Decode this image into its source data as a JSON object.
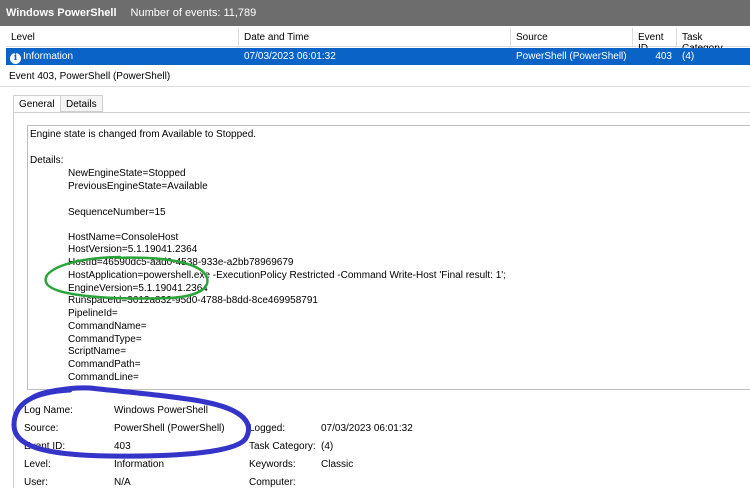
{
  "titlebar": {
    "title": "Windows PowerShell",
    "event_count": "Number of events: 11,789"
  },
  "grid": {
    "columns": [
      "Level",
      "Date and Time",
      "Source",
      "Event ID",
      "Task Category"
    ],
    "selected_row": {
      "level": "Information",
      "date_time": "07/03/2023 06:01:32",
      "source": "PowerShell (PowerShell)",
      "event_id": "403",
      "task_category": "(4)"
    }
  },
  "event": {
    "title": "Event 403, PowerShell (PowerShell)"
  },
  "tabs": {
    "general": "General",
    "details": "Details"
  },
  "message": {
    "summary": "Engine state is changed from Available to Stopped.",
    "details_label": "Details:",
    "lines": {
      "new_state": "NewEngineState=Stopped",
      "prev_state": "PreviousEngineState=Available",
      "seq": "SequenceNumber=15",
      "host_name": "HostName=ConsoleHost",
      "host_version": "HostVersion=5.1.19041.2364",
      "host_id": "HostId=46590dc5-aad0-4538-933e-a2bb78969679",
      "host_app": "HostApplication=powershell.exe -ExecutionPolicy Restricted -Command Write-Host 'Final result: 1';",
      "engine_version": "EngineVersion=5.1.19041.2364",
      "runspace_id": "RunspaceId=3612a832-95d0-4788-b8dd-8ce469958791",
      "pipeline_id": "PipelineId=",
      "command_name": "CommandName=",
      "command_type": "CommandType=",
      "script_name": "ScriptName=",
      "command_path": "CommandPath=",
      "command_line": "CommandLine="
    }
  },
  "meta": {
    "log_name_label": "Log Name:",
    "log_name_value": "Windows PowerShell",
    "source_label": "Source:",
    "source_value": "PowerShell (PowerShell)",
    "logged_label": "Logged:",
    "logged_value": "07/03/2023 06:01:32",
    "event_id_label": "Event ID:",
    "event_id_value": "403",
    "task_label": "Task Category:",
    "task_value": "(4)",
    "level_label": "Level:",
    "level_value": "Information",
    "keywords_label": "Keywords:",
    "keywords_value": "Classic",
    "user_label": "User:",
    "user_value": "N/A",
    "computer_label": "Computer:"
  },
  "colors": {
    "selection": "#0a64c8",
    "titlebar": "#6d6d6d",
    "green_annotation": "#2aa43a",
    "blue_annotation": "#3434c8"
  },
  "icons": {
    "level": "info-icon"
  }
}
